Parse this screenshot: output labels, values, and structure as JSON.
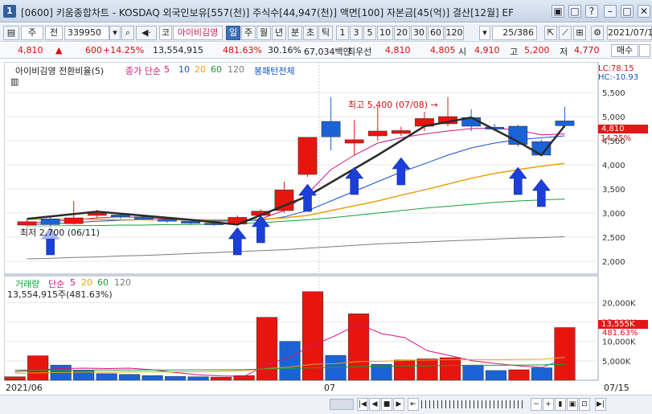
{
  "window": {
    "number": "1",
    "title": "[0600] 키움종합차트 - KOSDAQ 외국인보유[557(천)] 주식수[44,947(천)] 액면[100] 자본금[45(억)] 결산[12월] EF",
    "buttons": [
      "▣",
      "□",
      "?",
      "–",
      "□",
      "✕"
    ]
  },
  "toolbar": {
    "combo_prefix": "주",
    "combo_prefix2": "전",
    "code": "339950",
    "type_label": "코",
    "stock_name": "아이비김영",
    "periods": [
      "일",
      "주",
      "월",
      "년",
      "분",
      "초",
      "틱"
    ],
    "active_period": "일",
    "intervals": [
      "1",
      "3",
      "5",
      "10",
      "20",
      "30",
      "60",
      "120"
    ],
    "page": "25/386",
    "date": "2021/07/1"
  },
  "quote": {
    "price": "4,810",
    "change": "600",
    "change_pct": "+14.25%",
    "volume": "13,554,915",
    "volume_pct": "481.63%",
    "turnover": "30.16%",
    "amount": "67,034백만",
    "best_label": "최우선",
    "best_ask": "4,810",
    "best_bid": "4,805",
    "open_label": "시",
    "open": "4,910",
    "high_label": "고",
    "high": "5,200",
    "low_label": "저",
    "low": "4,770",
    "buy_label": "매수"
  },
  "price_panel": {
    "legend_name": "아이비김영 전환비율(5)",
    "ma_label": "종가 단순",
    "ma_periods": [
      "5",
      "10",
      "20",
      "60",
      "120"
    ],
    "ma_colors": [
      "#d4137e",
      "#1b4fd1",
      "#e8a20a",
      "#11a136",
      "#7a7a7a"
    ],
    "extra_label": "봉패턴전체",
    "lc": "LC:78.15",
    "hc": "HC:-10.93",
    "annot_high": "최고 5,400 (07/08) →",
    "annot_low": "최저 2,700 (06/11)",
    "current_price": "4,810",
    "current_pct": "14.25%",
    "y_ticks": [
      "5,500",
      "5,000",
      "4,500",
      "4,000",
      "3,500",
      "3,000",
      "2,500",
      "2,000"
    ]
  },
  "volume_panel": {
    "legend_name": "거래량",
    "ma_label": "단순",
    "ma_periods": [
      "5",
      "20",
      "60",
      "120"
    ],
    "info": "13,554,915주(481.63%)",
    "current": "13,555K",
    "current_pct": "481.63%",
    "y_ticks": [
      "20,000K",
      "15,000K",
      "10,000K",
      "5,000K"
    ]
  },
  "x_axis": {
    "labels": [
      "2021/06",
      "07",
      "07/15"
    ]
  },
  "chart_data": [
    {
      "type": "candlestick",
      "title": "아이비김영 전환비율(5)",
      "ylim": [
        1800,
        5800
      ],
      "candles": [
        {
          "o": 2750,
          "c": 2820,
          "h": 2870,
          "l": 2700,
          "dir": "up"
        },
        {
          "o": 2880,
          "c": 2760,
          "h": 2950,
          "l": 2700,
          "dir": "down"
        },
        {
          "o": 2780,
          "c": 2900,
          "h": 3250,
          "l": 2760,
          "dir": "up"
        },
        {
          "o": 2950,
          "c": 3000,
          "h": 3070,
          "l": 2900,
          "dir": "up"
        },
        {
          "o": 2960,
          "c": 2920,
          "h": 2990,
          "l": 2880,
          "dir": "down"
        },
        {
          "o": 2920,
          "c": 2870,
          "h": 2960,
          "l": 2850,
          "dir": "down"
        },
        {
          "o": 2870,
          "c": 2830,
          "h": 2900,
          "l": 2800,
          "dir": "down"
        },
        {
          "o": 2830,
          "c": 2790,
          "h": 2860,
          "l": 2760,
          "dir": "down"
        },
        {
          "o": 2790,
          "c": 2760,
          "h": 2820,
          "l": 2730,
          "dir": "down"
        },
        {
          "o": 2770,
          "c": 2910,
          "h": 2950,
          "l": 2740,
          "dir": "up"
        },
        {
          "o": 2950,
          "c": 3040,
          "h": 3080,
          "l": 2920,
          "dir": "up"
        },
        {
          "o": 3050,
          "c": 3480,
          "h": 3650,
          "l": 3000,
          "dir": "up"
        },
        {
          "o": 3800,
          "c": 4570,
          "h": 4570,
          "l": 3750,
          "dir": "up"
        },
        {
          "o": 4900,
          "c": 4580,
          "h": 5400,
          "l": 4300,
          "dir": "down"
        },
        {
          "o": 4450,
          "c": 4520,
          "h": 4930,
          "l": 4200,
          "dir": "up"
        },
        {
          "o": 4600,
          "c": 4700,
          "h": 5200,
          "l": 4500,
          "dir": "up"
        },
        {
          "o": 4650,
          "c": 4710,
          "h": 4790,
          "l": 4600,
          "dir": "up"
        },
        {
          "o": 4800,
          "c": 4960,
          "h": 5100,
          "l": 4700,
          "dir": "up"
        },
        {
          "o": 4850,
          "c": 5000,
          "h": 5400,
          "l": 4800,
          "dir": "up"
        },
        {
          "o": 4980,
          "c": 4800,
          "h": 5150,
          "l": 4700,
          "dir": "down"
        },
        {
          "o": 4780,
          "c": 4740,
          "h": 4850,
          "l": 4700,
          "dir": "down"
        },
        {
          "o": 4800,
          "c": 4420,
          "h": 4830,
          "l": 4380,
          "dir": "down"
        },
        {
          "o": 4480,
          "c": 4200,
          "h": 4520,
          "l": 4200,
          "dir": "down"
        },
        {
          "o": 4910,
          "c": 4810,
          "h": 5200,
          "l": 4770,
          "dir": "down"
        }
      ],
      "trend_line": [
        2880,
        3030,
        2860,
        2760,
        3350,
        4200,
        4800,
        4980,
        4480,
        4200,
        4810
      ],
      "ma5": [
        2800,
        2820,
        2860,
        2900,
        2920,
        2910,
        2880,
        2850,
        2830,
        2840,
        2880,
        3050,
        3400,
        3900,
        4200,
        4450,
        4560,
        4640,
        4700,
        4750,
        4760,
        4720,
        4620,
        4640
      ],
      "ma10": [
        2760,
        2780,
        2800,
        2830,
        2850,
        2860,
        2860,
        2850,
        2840,
        2840,
        2850,
        2920,
        3050,
        3250,
        3450,
        3650,
        3850,
        4020,
        4200,
        4350,
        4450,
        4520,
        4560,
        4600
      ],
      "ma20": [
        2870,
        2870,
        2870,
        2870,
        2860,
        2860,
        2860,
        2860,
        2860,
        2860,
        2870,
        2900,
        2950,
        3050,
        3150,
        3250,
        3370,
        3480,
        3600,
        3720,
        3820,
        3900,
        3970,
        4030
      ],
      "ma60": [
        2730,
        2730,
        2740,
        2740,
        2750,
        2750,
        2760,
        2760,
        2770,
        2780,
        2800,
        2830,
        2860,
        2900,
        2950,
        3000,
        3050,
        3100,
        3140,
        3180,
        3220,
        3250,
        3270,
        3290
      ],
      "ma120": [
        2050,
        2060,
        2080,
        2090,
        2110,
        2120,
        2140,
        2160,
        2180,
        2200,
        2220,
        2240,
        2270,
        2300,
        2330,
        2360,
        2380,
        2400,
        2420,
        2440,
        2460,
        2480,
        2490,
        2510
      ],
      "buy_arrows": [
        1,
        9,
        10,
        12,
        14,
        16,
        21,
        22
      ]
    },
    {
      "type": "bar",
      "title": "거래량",
      "ylim": [
        0,
        24000
      ],
      "values": [
        900,
        6300,
        3900,
        2600,
        1700,
        1500,
        1200,
        1000,
        900,
        800,
        1200,
        16200,
        10000,
        22800,
        6400,
        17100,
        4100,
        5200,
        5500,
        5800,
        3900,
        2500,
        2700,
        3200,
        13555
      ],
      "directions": [
        "up",
        "up",
        "down",
        "down",
        "down",
        "down",
        "down",
        "down",
        "down",
        "up",
        "up",
        "up",
        "down",
        "up",
        "down",
        "up",
        "down",
        "up",
        "up",
        "up",
        "down",
        "down",
        "up",
        "down",
        "up"
      ],
      "ma5": [
        2200,
        2600,
        3000,
        3100,
        3000,
        3100,
        2700,
        2000,
        1400,
        1100,
        1000,
        4000,
        6000,
        9000,
        11500,
        14500,
        12000,
        11000,
        7600,
        6300,
        5000,
        4300,
        3700,
        3300,
        5500
      ],
      "ma20": [
        1800,
        1900,
        2000,
        2050,
        2100,
        2150,
        2150,
        2150,
        2200,
        2300,
        2450,
        3000,
        3400,
        4100,
        4300,
        4800,
        4900,
        5100,
        5200,
        5300,
        5300,
        5300,
        5350,
        5400,
        5900
      ],
      "ma60": [
        2600,
        2600,
        2600,
        2600,
        2650,
        2650,
        2650,
        2650,
        2700,
        2700,
        2750,
        2900,
        3000,
        3200,
        3300,
        3500,
        3550,
        3650,
        3700,
        3800,
        3850,
        3850,
        3900,
        3950,
        4100
      ]
    }
  ]
}
